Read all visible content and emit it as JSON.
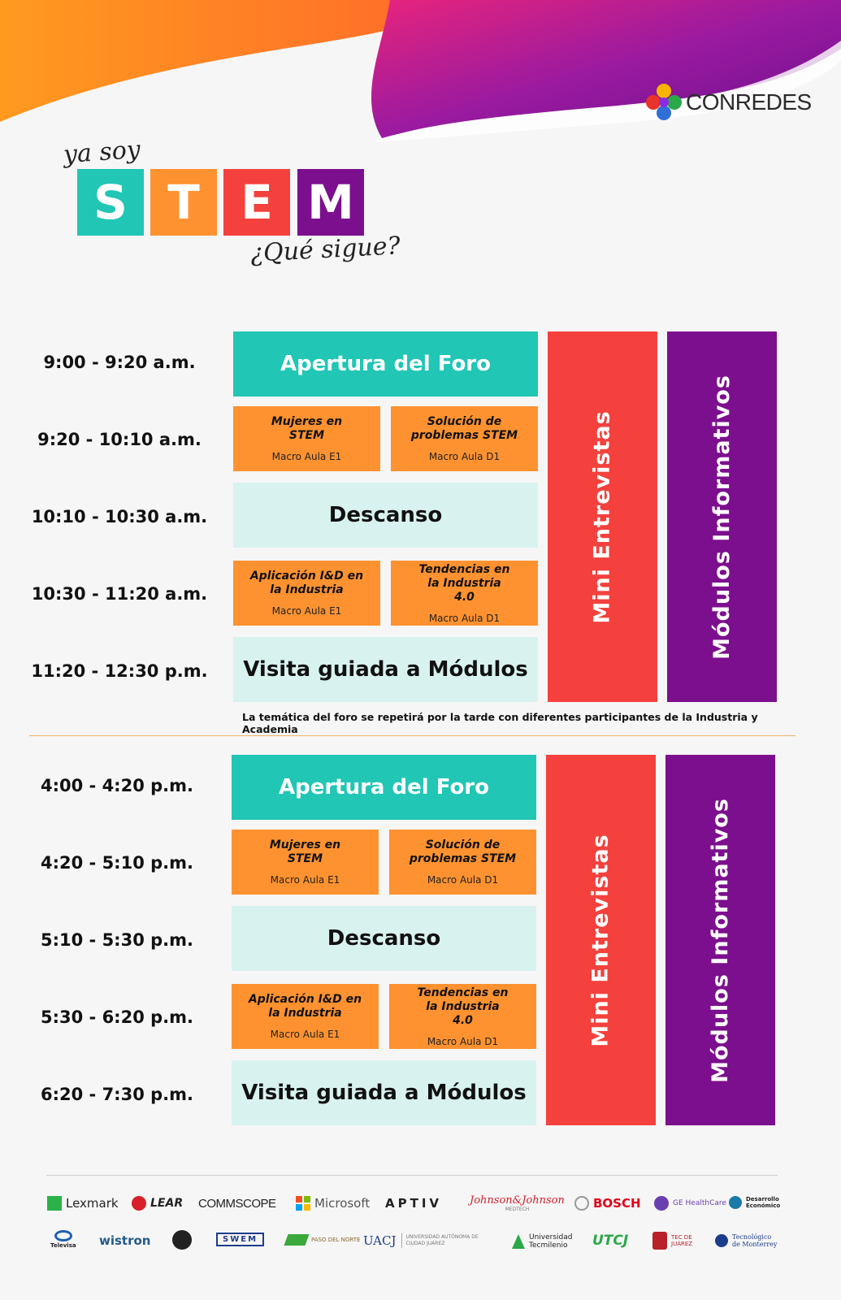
{
  "brand": {
    "name": "CONREDES",
    "icon": "conredes-logo-icon"
  },
  "logo": {
    "top_text": "ya soy",
    "letters": [
      "S",
      "T",
      "E",
      "M"
    ],
    "bottom_text": "¿Qué sigue?"
  },
  "colors": {
    "teal": "#21c6b5",
    "orange": "#ff9230",
    "red": "#f4413d",
    "purple": "#7c0f8e",
    "light_teal": "#d8f2ef"
  },
  "morning": {
    "times": [
      "9:00 - 9:20 a.m.",
      "9:20 - 10:10 a.m.",
      "10:10 - 10:30 a.m.",
      "10:30 - 11:20 a.m.",
      "11:20 - 12:30 p.m."
    ],
    "opening": "Apertura del Foro",
    "sessions1": [
      {
        "title": "Mujeres en STEM",
        "room": "Macro Aula E1"
      },
      {
        "title": "Solución de problemas STEM",
        "room": "Macro Aula D1"
      }
    ],
    "break": "Descanso",
    "sessions2": [
      {
        "title": "Aplicación I&D en la Industria",
        "room": "Macro Aula E1"
      },
      {
        "title": "Tendencias en la Industria 4.0",
        "room": "Macro Aula D1"
      }
    ],
    "tour": "Visita guiada a Módulos",
    "side1": "Mini Entrevistas",
    "side2": "Módulos Informativos"
  },
  "note": "La temática del foro se repetirá por la tarde con diferentes participantes de la Industria y Academia",
  "afternoon": {
    "times": [
      "4:00 - 4:20 p.m.",
      "4:20 - 5:10 p.m.",
      "5:10 - 5:30 p.m.",
      "5:30 - 6:20 p.m.",
      "6:20 - 7:30 p.m."
    ],
    "opening": "Apertura del Foro",
    "sessions1": [
      {
        "title": "Mujeres en STEM",
        "room": "Macro Aula E1"
      },
      {
        "title": "Solución de problemas STEM",
        "room": "Macro Aula D1"
      }
    ],
    "break": "Descanso",
    "sessions2": [
      {
        "title": "Aplicación I&D en la Industria",
        "room": "Macro Aula E1"
      },
      {
        "title": "Tendencias en la Industria 4.0",
        "room": "Macro Aula D1"
      }
    ],
    "tour": "Visita guiada a Módulos",
    "side1": "Mini Entrevistas",
    "side2": "Módulos Informativos"
  },
  "sponsors": {
    "row1": [
      "Lexmark",
      "LEAR",
      "COMMSCOPE",
      "Microsoft",
      "APTIV",
      "Johnson&Johnson",
      "BOSCH",
      "GE HealthCare",
      "Desarrollo Económico"
    ],
    "row2": [
      "Televisa",
      "wistron",
      "",
      "SWEM",
      "PASO DEL NORTE",
      "UACJ",
      "Universidad Tecmilenio",
      "UTCJ",
      "TEC DE JUÁREZ",
      "Tecnológico de Monterrey"
    ],
    "row1_sub": {
      "johnson": "MEDTECH"
    },
    "uacj_sub": "UNIVERSIDAD AUTÓNOMA DE CIUDAD JUÁREZ"
  }
}
